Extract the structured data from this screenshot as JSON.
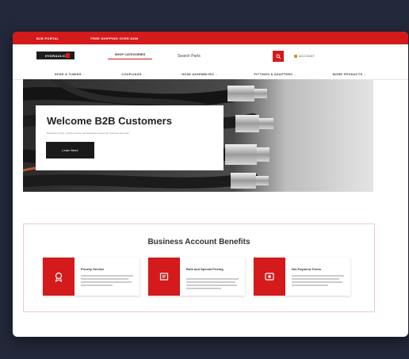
{
  "topbar": {
    "link1": "B2B PORTAL",
    "link2": "FREE SHIPPING OVER $499"
  },
  "header": {
    "logo": "HYDRAULIC",
    "shop_categories": "SHOP CATEGORIES",
    "search_placeholder": "Search Parts",
    "account": "ACCOUNT"
  },
  "nav": [
    "HOSE & TUBING",
    "COUPLINGS",
    "HOSE ASSEMBLIES",
    "FITTINGS & ADAPTERS",
    "MORE PRODUCTS"
  ],
  "hero": {
    "title": "Welcome B2B Customers",
    "subtitle": "Exclusive pricing, priority service and dedicated support for business accounts",
    "button": "Learn More"
  },
  "benefits": {
    "title": "Business Account Benefits",
    "items": [
      {
        "title": "Priority Service",
        "icon": "medal-icon"
      },
      {
        "title": "Bulk and Special Pricing",
        "icon": "pricing-icon"
      },
      {
        "title": "Net Payment Terms",
        "icon": "payment-icon"
      }
    ]
  },
  "colors": {
    "accent": "#d41a1a",
    "background": "#23283a"
  }
}
